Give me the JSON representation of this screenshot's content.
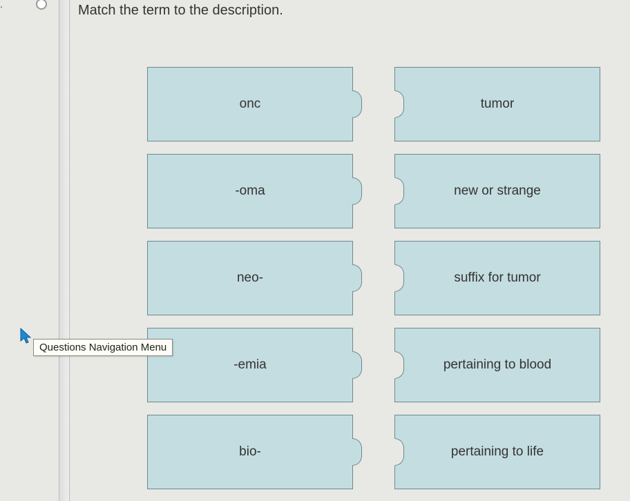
{
  "question_number_suffix": ".",
  "question_text": "Match the term to the description.",
  "tooltip_label": "Questions Navigation Menu",
  "terms": [
    {
      "label": "onc"
    },
    {
      "label": "-oma"
    },
    {
      "label": "neo-"
    },
    {
      "label": "-emia"
    },
    {
      "label": "bio-"
    }
  ],
  "descriptions": [
    {
      "label": "tumor"
    },
    {
      "label": "new or strange"
    },
    {
      "label": "suffix for tumor"
    },
    {
      "label": "pertaining to blood"
    },
    {
      "label": "pertaining to life"
    }
  ]
}
